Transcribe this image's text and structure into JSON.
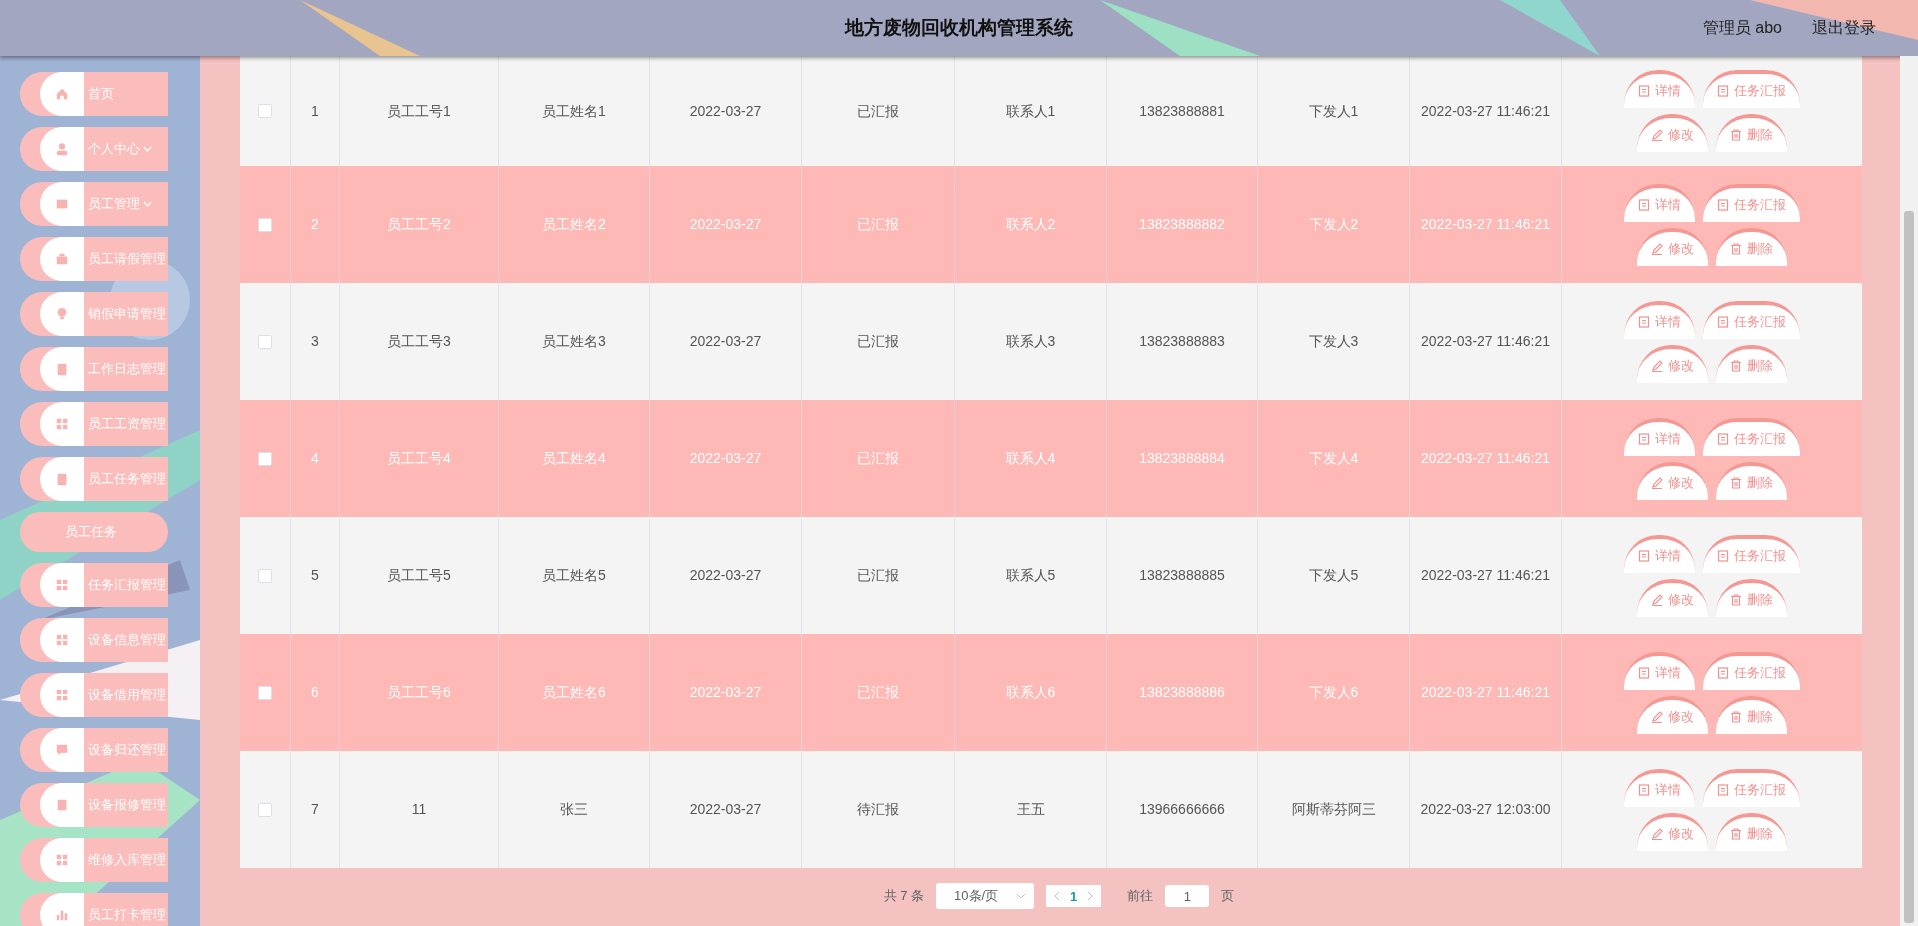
{
  "header": {
    "title": "地方废物回收机构管理系统",
    "user": "管理员 abo",
    "logout": "退出登录"
  },
  "sidebar": {
    "items": [
      {
        "label": "首页",
        "kind": "item"
      },
      {
        "label": "个人中心",
        "kind": "group",
        "expanded": false
      },
      {
        "label": "员工管理",
        "kind": "group",
        "expanded": false
      },
      {
        "label": "员工请假管理",
        "kind": "item"
      },
      {
        "label": "销假申请管理",
        "kind": "item"
      },
      {
        "label": "工作日志管理",
        "kind": "item"
      },
      {
        "label": "员工工资管理",
        "kind": "item"
      },
      {
        "label": "员工任务管理",
        "kind": "item"
      },
      {
        "label": "员工任务",
        "kind": "child"
      },
      {
        "label": "任务汇报管理",
        "kind": "item"
      },
      {
        "label": "设备信息管理",
        "kind": "item"
      },
      {
        "label": "设备借用管理",
        "kind": "item"
      },
      {
        "label": "设备归还管理",
        "kind": "item"
      },
      {
        "label": "设备报修管理",
        "kind": "item"
      },
      {
        "label": "维修入库管理",
        "kind": "item"
      },
      {
        "label": "员工打卡管理",
        "kind": "item"
      }
    ]
  },
  "table": {
    "rows": [
      {
        "checked": false,
        "cells": [
          "1",
          "员工工号1",
          "员工姓名1",
          "2022-03-27",
          "已汇报",
          "联系人1",
          "13823888881",
          "下发人1",
          "2022-03-27 11:46:21"
        ],
        "actions": [
          {
            "label": "详情",
            "kind": "detail"
          },
          {
            "label": "任务汇报",
            "kind": "report"
          },
          {
            "label": "修改",
            "kind": "edit"
          },
          {
            "label": "删除",
            "kind": "delete"
          }
        ]
      },
      {
        "checked": false,
        "cells": [
          "2",
          "员工工号2",
          "员工姓名2",
          "2022-03-27",
          "已汇报",
          "联系人2",
          "13823888882",
          "下发人2",
          "2022-03-27 11:46:21"
        ],
        "actions": [
          {
            "label": "详情",
            "kind": "detail"
          },
          {
            "label": "任务汇报",
            "kind": "report"
          },
          {
            "label": "修改",
            "kind": "edit"
          },
          {
            "label": "删除",
            "kind": "delete"
          }
        ]
      },
      {
        "checked": false,
        "cells": [
          "3",
          "员工工号3",
          "员工姓名3",
          "2022-03-27",
          "已汇报",
          "联系人3",
          "13823888883",
          "下发人3",
          "2022-03-27 11:46:21"
        ],
        "actions": [
          {
            "label": "详情",
            "kind": "detail"
          },
          {
            "label": "任务汇报",
            "kind": "report"
          },
          {
            "label": "修改",
            "kind": "edit"
          },
          {
            "label": "删除",
            "kind": "delete"
          }
        ]
      },
      {
        "checked": false,
        "cells": [
          "4",
          "员工工号4",
          "员工姓名4",
          "2022-03-27",
          "已汇报",
          "联系人4",
          "13823888884",
          "下发人4",
          "2022-03-27 11:46:21"
        ],
        "actions": [
          {
            "label": "详情",
            "kind": "detail"
          },
          {
            "label": "任务汇报",
            "kind": "report"
          },
          {
            "label": "修改",
            "kind": "edit"
          },
          {
            "label": "删除",
            "kind": "delete"
          }
        ]
      },
      {
        "checked": false,
        "cells": [
          "5",
          "员工工号5",
          "员工姓名5",
          "2022-03-27",
          "已汇报",
          "联系人5",
          "13823888885",
          "下发人5",
          "2022-03-27 11:46:21"
        ],
        "actions": [
          {
            "label": "详情",
            "kind": "detail"
          },
          {
            "label": "任务汇报",
            "kind": "report"
          },
          {
            "label": "修改",
            "kind": "edit"
          },
          {
            "label": "删除",
            "kind": "delete"
          }
        ]
      },
      {
        "checked": false,
        "cells": [
          "6",
          "员工工号6",
          "员工姓名6",
          "2022-03-27",
          "已汇报",
          "联系人6",
          "13823888886",
          "下发人6",
          "2022-03-27 11:46:21"
        ],
        "actions": [
          {
            "label": "详情",
            "kind": "detail"
          },
          {
            "label": "任务汇报",
            "kind": "report"
          },
          {
            "label": "修改",
            "kind": "edit"
          },
          {
            "label": "删除",
            "kind": "delete"
          }
        ]
      },
      {
        "checked": false,
        "cells": [
          "7",
          "11",
          "张三",
          "2022-03-27",
          "待汇报",
          "王五",
          "13966666666",
          "阿斯蒂芬阿三",
          "2022-03-27 12:03:00"
        ],
        "actions": [
          {
            "label": "详情",
            "kind": "detail"
          },
          {
            "label": "任务汇报",
            "kind": "report"
          },
          {
            "label": "修改",
            "kind": "edit"
          },
          {
            "label": "删除",
            "kind": "delete"
          }
        ]
      }
    ]
  },
  "pagination": {
    "total": "共 7 条",
    "page_size": "10条/页",
    "pages": [
      {
        "label": "1",
        "selected": true
      }
    ],
    "goto_label": "前往",
    "goto_value": "1",
    "goto_suffix": "页"
  }
}
